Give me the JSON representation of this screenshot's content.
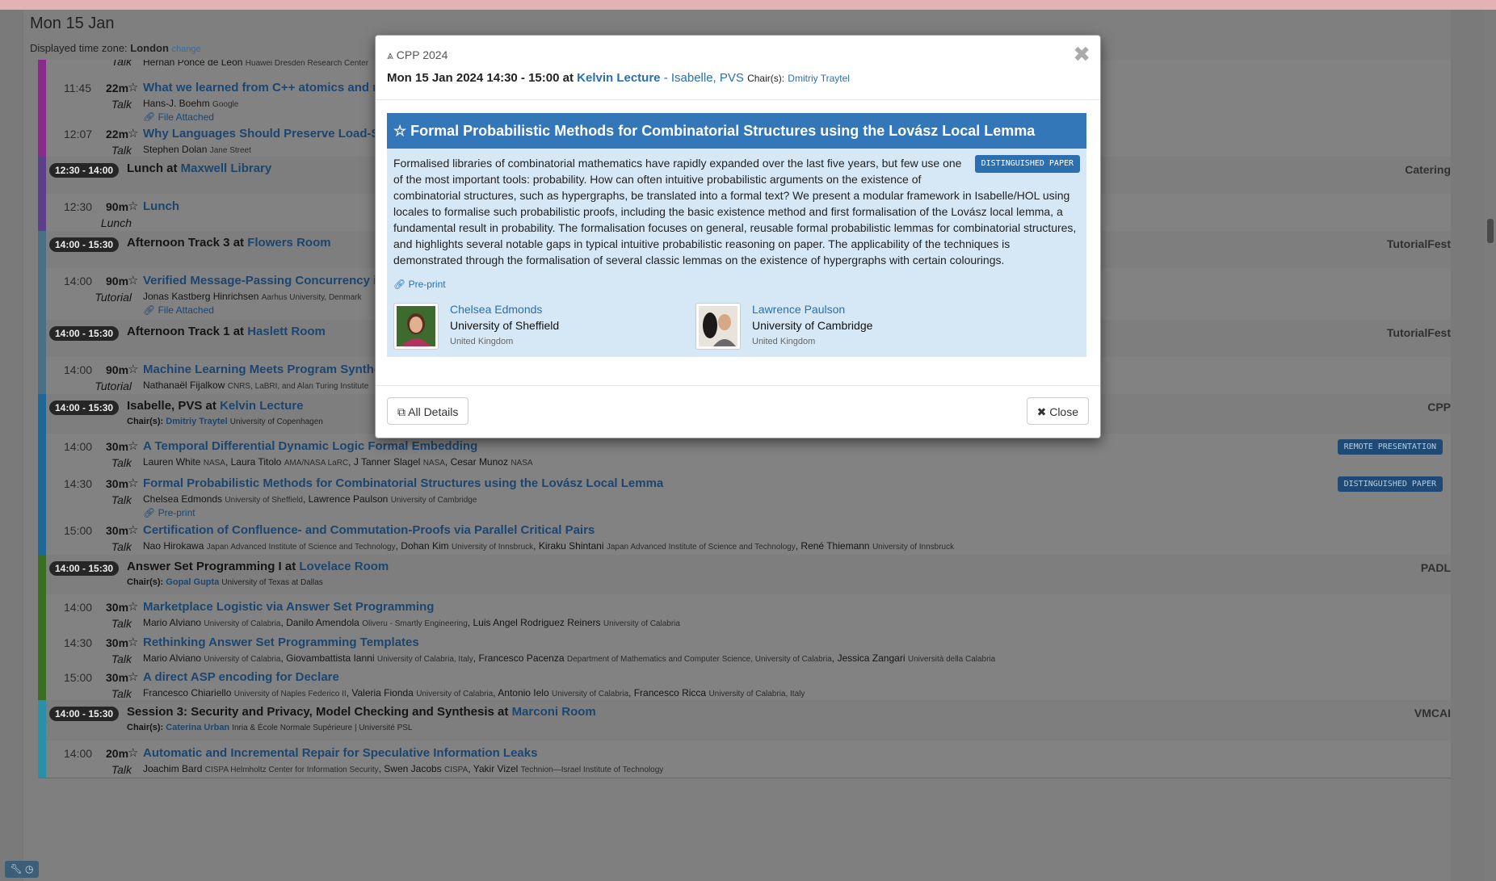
{
  "header": {
    "day": "Mon 15 Jan",
    "tz_label": "Displayed time zone:",
    "tz_value": "London",
    "tz_change": "change"
  },
  "rows": {
    "r0": {
      "auth": "Hernán Ponce de León",
      "aff": "Huawei Dresden Research Center",
      "type": "Talk"
    },
    "r1": {
      "time": "11:45",
      "dur": "22m",
      "type": "Talk",
      "title": "What we learned from C++ atomics and memory model standardization",
      "auth": "Hans-J. Boehm",
      "aff": "Google",
      "link": "File Attached"
    },
    "r2": {
      "time": "12:07",
      "dur": "22m",
      "type": "Talk",
      "title": "Why Languages Should Preserve Load-Store Order",
      "auth": "Stephen Dolan",
      "aff": "Jane Street"
    },
    "h1": {
      "pill": "12:30 - 14:00",
      "title_pre": "Lunch at",
      "room": "Maxwell Library",
      "tag": "Catering"
    },
    "r3": {
      "time": "12:30",
      "dur": "90m",
      "type": "Lunch",
      "title": "Lunch"
    },
    "h2": {
      "pill": "14:00 - 15:30",
      "title_pre": "Afternoon Track 3 at",
      "room": "Flowers Room",
      "tag": "TutorialFest"
    },
    "r4": {
      "time": "14:00",
      "dur": "90m",
      "type": "Tutorial",
      "title": "Verified Message-Passing Concurrency in Iris",
      "auth": "Jonas Kastberg Hinrichsen",
      "aff": "Aarhus University, Denmark",
      "link": "File Attached"
    },
    "h3": {
      "pill": "14:00 - 15:30",
      "title_pre": "Afternoon Track 1 at",
      "room": "Haslett Room",
      "tag": "TutorialFest"
    },
    "r5": {
      "time": "14:00",
      "dur": "90m",
      "type": "Tutorial",
      "title": "Machine Learning Meets Program Synthesis",
      "auth": "Nathanaël Fijalkow",
      "aff": "CNRS, LaBRI, and Alan Turing Institute"
    },
    "h4": {
      "pill": "14:00 - 15:30",
      "title_pre": "Isabelle, PVS at",
      "room": "Kelvin Lecture",
      "tag": "CPP",
      "chair_label": "Chair(s):",
      "chair": "Dmitriy Traytel",
      "chair_aff": "University of Copenhagen"
    },
    "r6": {
      "time": "14:00",
      "dur": "30m",
      "type": "Talk",
      "title": "A Temporal Differential Dynamic Logic Formal Embedding",
      "badge": "REMOTE PRESENTATION",
      "a1": "Lauren White",
      "f1": "NASA",
      "a2": "Laura Titolo",
      "f2": "AMA/NASA LaRC",
      "a3": "J Tanner Slagel",
      "f3": "NASA",
      "a4": "Cesar Munoz",
      "f4": "NASA"
    },
    "r7": {
      "time": "14:30",
      "dur": "30m",
      "type": "Talk",
      "title": "Formal Probabilistic Methods for Combinatorial Structures using the Lovász Local Lemma",
      "badge": "DISTINGUISHED PAPER",
      "a1": "Chelsea Edmonds",
      "f1": "University of Sheffield",
      "a2": "Lawrence Paulson",
      "f2": "University of Cambridge",
      "link": "Pre-print"
    },
    "r8": {
      "time": "15:00",
      "dur": "30m",
      "type": "Talk",
      "title": "Certification of Confluence- and Commutation-Proofs via Parallel Critical Pairs",
      "a1": "Nao Hirokawa",
      "f1": "Japan Advanced Institute of Science and Technology",
      "a2": "Dohan Kim",
      "f2": "University of Innsbruck",
      "a3": "Kiraku Shintani",
      "f3": "Japan Advanced Institute of Science and Technology",
      "a4": "René Thiemann",
      "f4": "University of Innsbruck"
    },
    "h5": {
      "pill": "14:00 - 15:30",
      "title_pre": "Answer Set Programming I at",
      "room": "Lovelace Room",
      "tag": "PADL",
      "chair_label": "Chair(s):",
      "chair": "Gopal Gupta",
      "chair_aff": "University of Texas at Dallas"
    },
    "r9": {
      "time": "14:00",
      "dur": "30m",
      "type": "Talk",
      "title": "Marketplace Logistic via Answer Set Programming",
      "a1": "Mario Alviano",
      "f1": "University of Calabria",
      "a2": "Danilo Amendola",
      "f2": "Oliveru - Smartly Engineering",
      "a3": "Luis Angel Rodriguez Reiners",
      "f3": "University of Calabria"
    },
    "r10": {
      "time": "14:30",
      "dur": "30m",
      "type": "Talk",
      "title": "Rethinking Answer Set Programming Templates",
      "a1": "Mario Alviano",
      "f1": "University of Calabria",
      "a2": "Giovambattista Ianni",
      "f2": "University of Calabria, Italy",
      "a3": "Francesco Pacenza",
      "f3": "Department of Mathematics and Computer Science, University of Calabria",
      "a4": "Jessica Zangari",
      "f4": "Università della Calabria"
    },
    "r11": {
      "time": "15:00",
      "dur": "30m",
      "type": "Talk",
      "title": "A direct ASP encoding for Declare",
      "a1": "Francesco Chiariello",
      "f1": "University of Naples Federico II",
      "a2": "Valeria Fionda",
      "f2": "University of Calabria",
      "a3": "Antonio Ielo",
      "f3": "University of Calabria",
      "a4": "Francesco Ricca",
      "f4": "University of Calabria, Italy"
    },
    "h6": {
      "pill": "14:00 - 15:30",
      "title_pre": "Session 3: Security and Privacy, Model Checking and Synthesis at",
      "room": "Marconi Room",
      "tag": "VMCAI",
      "chair_label": "Chair(s):",
      "chair": "Caterina Urban",
      "chair_aff": "Inria & École Normale Supérieure | Université PSL"
    },
    "r12": {
      "time": "14:00",
      "dur": "20m",
      "type": "Talk",
      "title": "Automatic and Incremental Repair for Speculative Information Leaks",
      "a1": "Joachim Bard",
      "f1": "CISPA Helmholtz Center for Information Security",
      "a2": "Swen Jacobs",
      "f2": "CISPA",
      "a3": "Yakir Vizel",
      "f3": "Technion—Israel Institute of Technology"
    }
  },
  "modal": {
    "conf": "CPP 2024",
    "datetime": "Mon 15 Jan 2024 14:30 - 15:00 at",
    "room": "Kelvin Lecture",
    "dash": "-",
    "session": "Isabelle, PVS",
    "chair_label": "Chair(s):",
    "chair": "Dmitriy Traytel",
    "title": "Formal Probabilistic Methods for Combinatorial Structures using the Lovász Local Lemma",
    "badge": "DISTINGUISHED PAPER",
    "abstract": "Formalised libraries of combinatorial mathematics have rapidly expanded over the last five years, but few use one of the most important tools: probability. How can often intuitive probabilistic arguments on the existence of combinatorial structures, such as hypergraphs, be translated into a formal text? We present a modular framework in Isabelle/HOL using locales to formalise such probabilistic proofs, including the basic existence method and first formalisation of the Lovász local lemma, a fundamental result in probability. The formalisation focuses on general, reusable formal probabilistic lemmas for combinatorial structures, and highlights several notable gaps in typical intuitive probabilistic reasoning on paper. The applicability of the techniques is demonstrated through the formalisation of several classic lemmas on the existence of hypergraphs with certain colourings.",
    "preprint": "Pre-print",
    "authors": [
      {
        "name": "Chelsea Edmonds",
        "aff": "University of Sheffield",
        "country": "United Kingdom"
      },
      {
        "name": "Lawrence Paulson",
        "aff": "University of Cambridge",
        "country": "United Kingdom"
      }
    ],
    "all_details": "All Details",
    "close": "Close"
  },
  "colors": {
    "accent": "#3377b8",
    "link": "#2a6fb0",
    "card_bg": "#d6e8f5",
    "cpp_bar": "#1f6796",
    "padl_bar": "#3a6f22",
    "vmcai_bar": "#2a8fa8"
  }
}
